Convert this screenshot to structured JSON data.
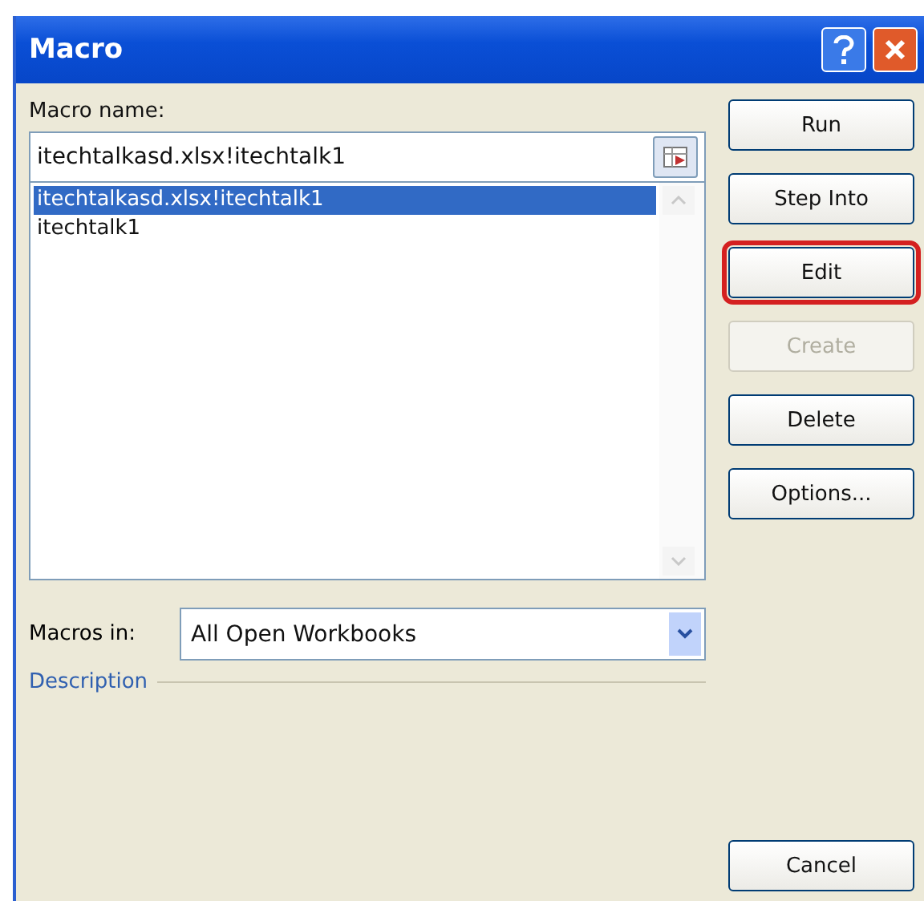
{
  "window": {
    "title": "Macro"
  },
  "macro_name": {
    "label": "Macro name:",
    "value": "itechtalkasd.xlsx!itechtalk1"
  },
  "macro_list": [
    {
      "label": "itechtalkasd.xlsx!itechtalk1",
      "selected": true
    },
    {
      "label": "itechtalk1",
      "selected": false
    }
  ],
  "buttons": [
    {
      "label": "Run",
      "disabled": false,
      "highlighted": false
    },
    {
      "label": "Step Into",
      "disabled": false,
      "highlighted": false
    },
    {
      "label": "Edit",
      "disabled": false,
      "highlighted": true
    },
    {
      "label": "Create",
      "disabled": true,
      "highlighted": false
    },
    {
      "label": "Delete",
      "disabled": false,
      "highlighted": false
    },
    {
      "label": "Options...",
      "disabled": false,
      "highlighted": false
    }
  ],
  "macros_in": {
    "label": "Macros in:",
    "value": "All Open Workbooks"
  },
  "description": {
    "label": "Description"
  },
  "cancel_button": {
    "label": "Cancel"
  }
}
